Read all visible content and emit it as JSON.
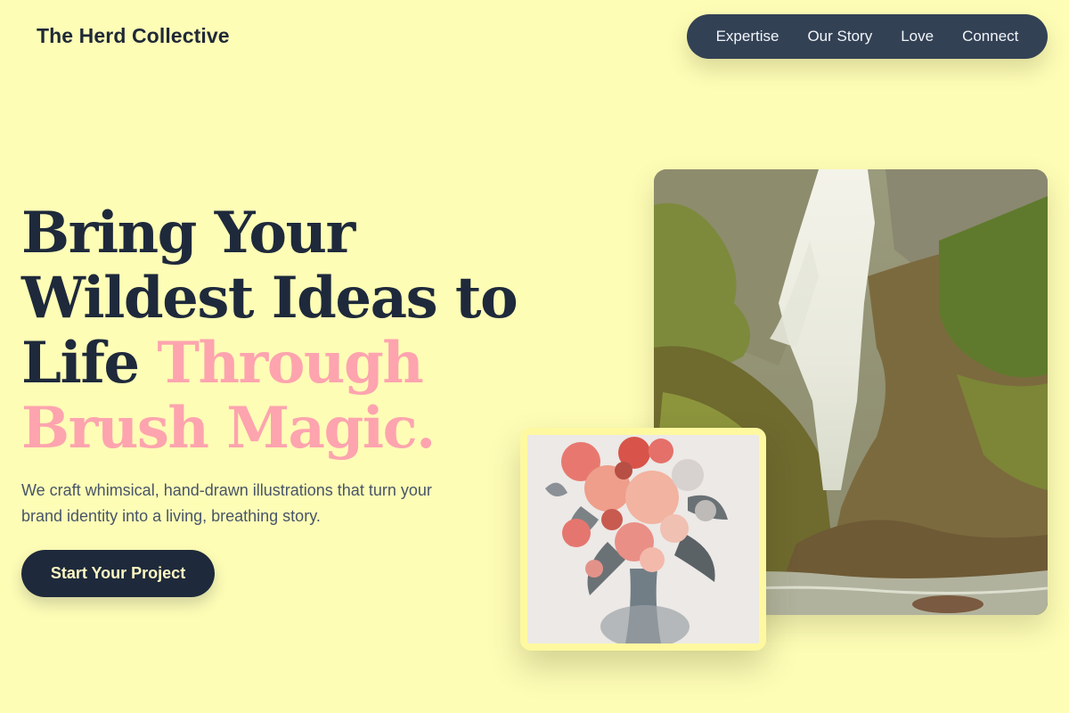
{
  "header": {
    "brand": "The Herd Collective",
    "nav": [
      {
        "label": "Expertise"
      },
      {
        "label": "Our Story"
      },
      {
        "label": "Love"
      },
      {
        "label": "Connect"
      }
    ]
  },
  "hero": {
    "title_line_1": "Bring Your",
    "title_line_2": "Wildest Ideas to",
    "title_line_3_plain": "Life",
    "title_line_3_accent": "Through",
    "title_line_4_accent": "Brush Magic.",
    "subtitle": "We craft whimsical, hand-drawn illustrations that turn your brand identity into a living, breathing story.",
    "cta_label": "Start Your Project"
  },
  "images": {
    "main": "waterfall-illustration",
    "secondary": "flower-bouquet-illustration"
  },
  "colors": {
    "background": "#fefdb6",
    "nav_background": "#334155",
    "heading": "#1e293b",
    "accent": "#fda4af",
    "cta_background": "#1e293b",
    "cta_text": "#fef9c3"
  }
}
